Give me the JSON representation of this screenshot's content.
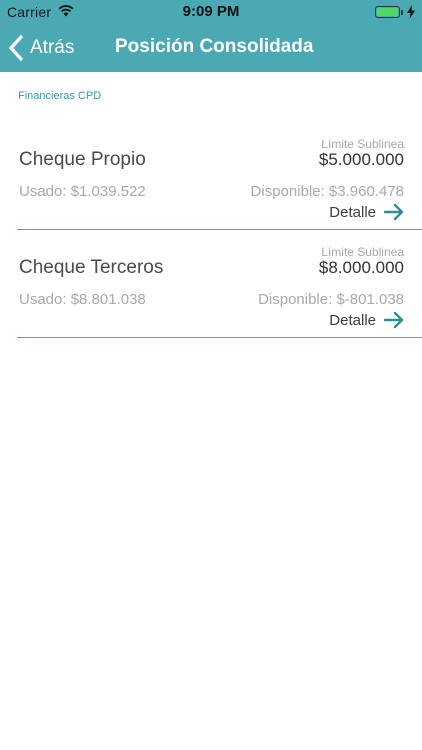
{
  "status_bar": {
    "carrier": "Carrier",
    "time": "9:09 PM"
  },
  "nav": {
    "back_label": "Atrás",
    "title": "Posición Consolidada"
  },
  "section": {
    "label": "Financieras CPD"
  },
  "items": [
    {
      "name": "Cheque Propio",
      "limit_label": "Límite Sublinea",
      "limit_value": "$5.000.000",
      "used": "Usado: $1.039.522",
      "available": "Disponible: $3.960.478",
      "detail_label": "Detalle"
    },
    {
      "name": "Cheque Terceros",
      "limit_label": "Límite Sublinea",
      "limit_value": "$8.000.000",
      "used": "Usado: $8.801.038",
      "available": "Disponible: $-801.038",
      "detail_label": "Detalle"
    }
  ],
  "colors": {
    "accent": "#4aa9b3",
    "muted_text": "#a9a9a9",
    "primary_text": "#4a4a4a"
  }
}
